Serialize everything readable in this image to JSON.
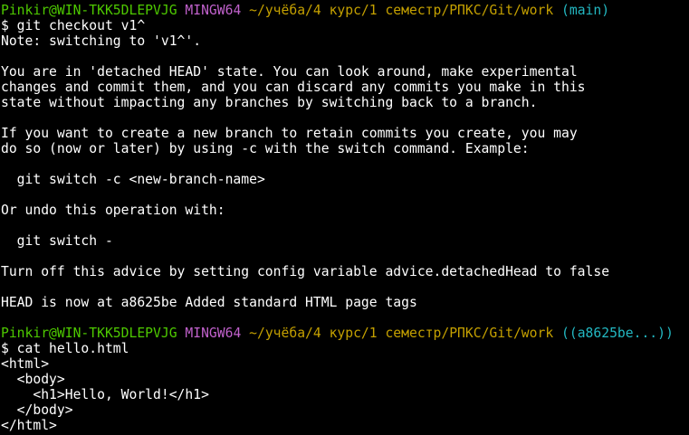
{
  "colors": {
    "background": "#000000",
    "text": "#ffffff",
    "user_host": "#4ec900",
    "shell": "#c061cb",
    "path": "#c4a000",
    "branch": "#23b8c2"
  },
  "prompt1": {
    "user_host": "Pinkir@WIN-TKK5DLEPVJG",
    "shell": "MINGW64",
    "path": "~/учёба/4 курс/1 семестр/РПКС/Git/work",
    "branch": "(main)"
  },
  "command1": "$ git checkout v1^",
  "output1": [
    "Note: switching to 'v1^'.",
    "",
    "You are in 'detached HEAD' state. You can look around, make experimental",
    "changes and commit them, and you can discard any commits you make in this",
    "state without impacting any branches by switching back to a branch.",
    "",
    "If you want to create a new branch to retain commits you create, you may",
    "do so (now or later) by using -c with the switch command. Example:",
    "",
    "  git switch -c <new-branch-name>",
    "",
    "Or undo this operation with:",
    "",
    "  git switch -",
    "",
    "Turn off this advice by setting config variable advice.detachedHead to false",
    "",
    "HEAD is now at a8625be Added standard HTML page tags",
    ""
  ],
  "prompt2": {
    "user_host": "Pinkir@WIN-TKK5DLEPVJG",
    "shell": "MINGW64",
    "path": "~/учёба/4 курс/1 семестр/РПКС/Git/work",
    "branch": "((a8625be...))"
  },
  "command2": "$ cat hello.html",
  "output2": [
    "<html>",
    "  <body>",
    "    <h1>Hello, World!</h1>",
    "  </body>",
    "</html>"
  ]
}
